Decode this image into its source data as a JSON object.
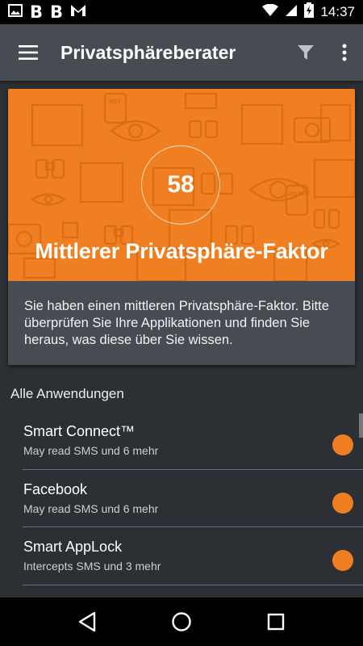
{
  "status_bar": {
    "letters": [
      "B",
      "B"
    ],
    "time": "14:37",
    "icons": [
      "image-icon",
      "gmail-icon",
      "wifi-icon",
      "signal-icon",
      "battery-charging-icon"
    ]
  },
  "app_bar": {
    "title": "Privatsphäreberater",
    "icons": [
      "hamburger-menu-icon",
      "filter-icon",
      "more-vert-icon"
    ]
  },
  "privacy_card": {
    "score": "58",
    "label": "Mittlerer Privatsphäre-Faktor",
    "description": "Sie haben einen mittleren Privatsphäre-Faktor. Bitte überprüfen Sie Ihre Applikationen und finden Sie heraus, was diese über Sie wissen.",
    "accent_color": "#f07f21",
    "background_stamps": [
      "NOT",
      "DO NOT"
    ]
  },
  "apps_section": {
    "title": "Alle Anwendungen",
    "items": [
      {
        "name": "Smart Connect™",
        "detail": "May read SMS und 6 mehr",
        "risk_color": "#f07f21"
      },
      {
        "name": "Facebook",
        "detail": "May read SMS und 6 mehr",
        "risk_color": "#f07f21"
      },
      {
        "name": "Smart AppLock",
        "detail": "Intercepts SMS und 3 mehr",
        "risk_color": "#f07f21"
      }
    ]
  },
  "nav_bar": {
    "icons": [
      "back-icon",
      "home-icon",
      "recents-icon"
    ]
  }
}
